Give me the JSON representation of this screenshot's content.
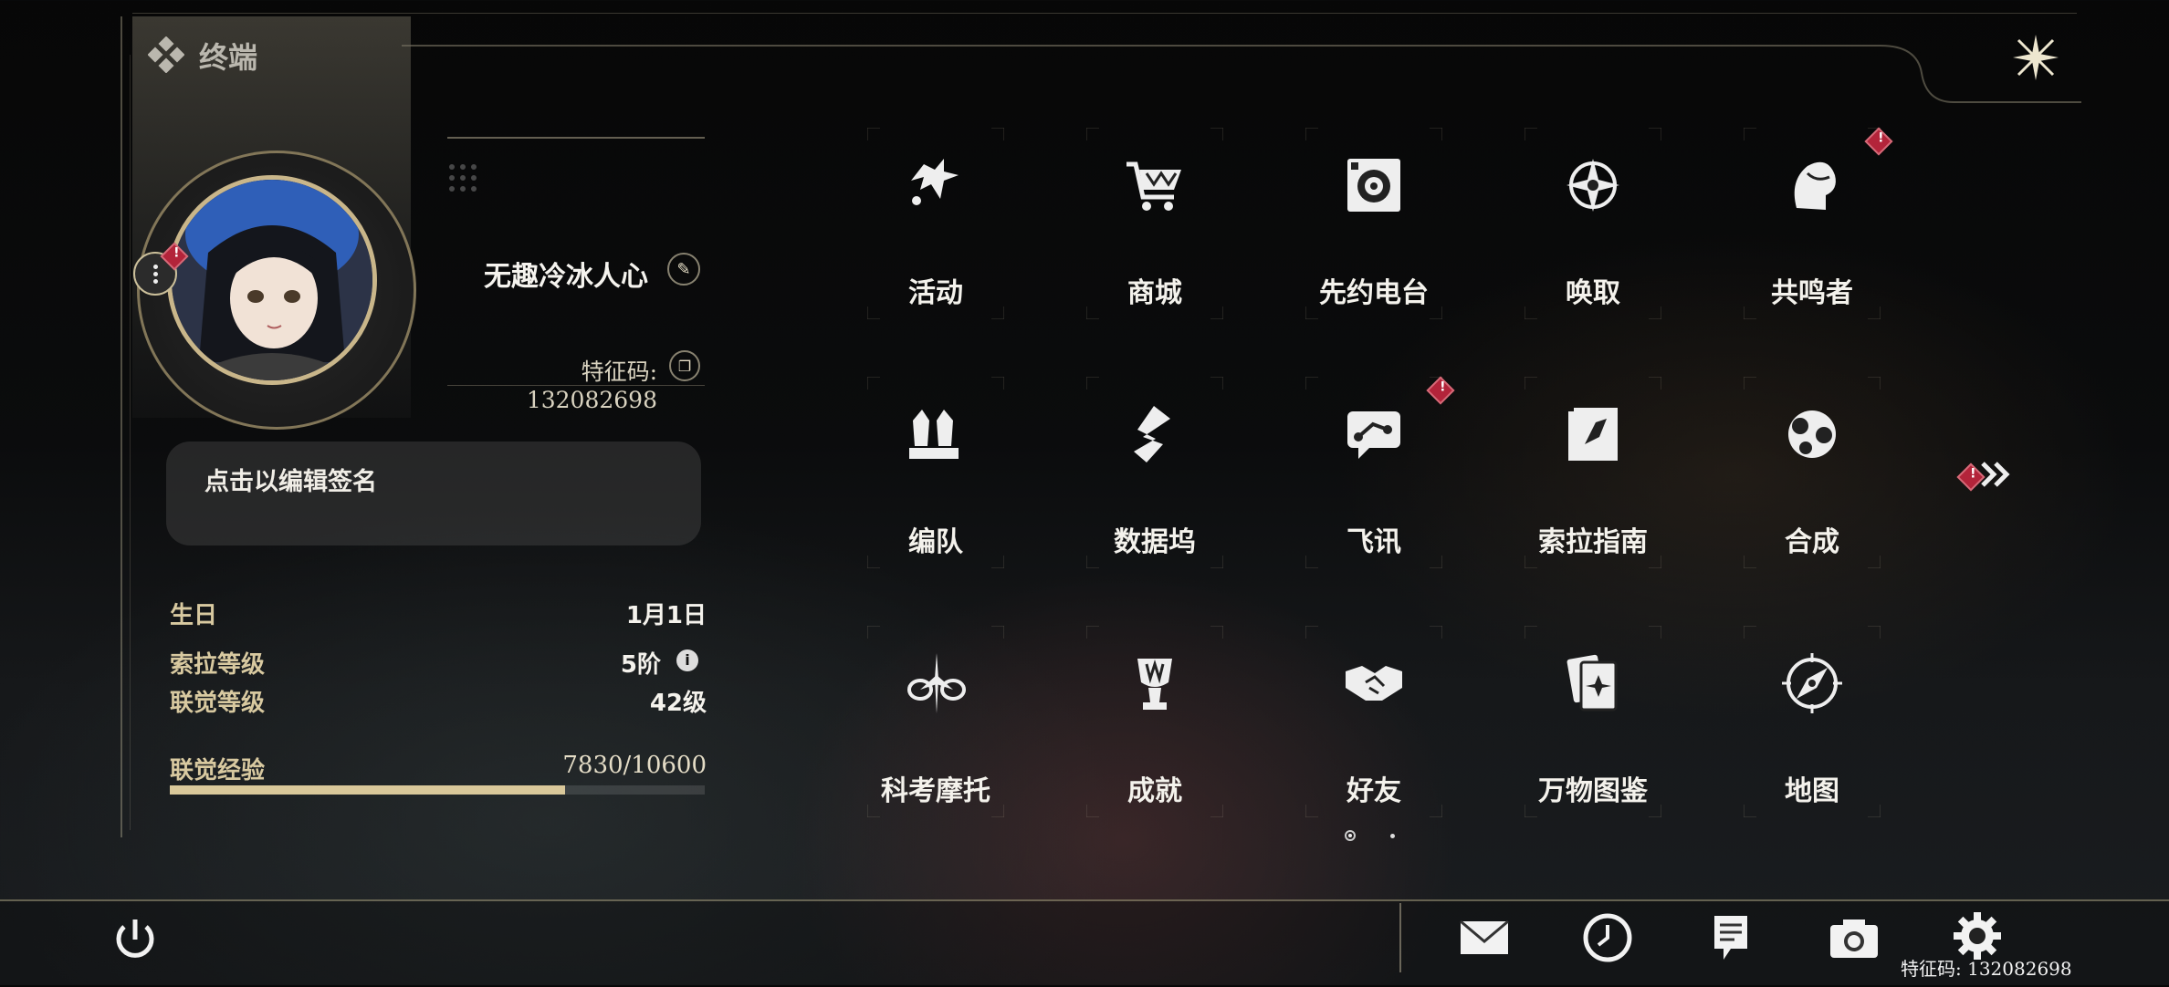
{
  "header": {
    "title": "终端",
    "close_icon": "close-star-icon"
  },
  "profile": {
    "name": "无趣冷冰人心",
    "id_label": "特征码",
    "id_value": "132082698",
    "id_text": "特征码: 132082698",
    "signature_placeholder": "点击以编辑签名"
  },
  "stats": {
    "birthday_label": "生日",
    "birthday_value": "1月1日",
    "sola_level_label": "索拉等级",
    "sola_level_value": "5阶",
    "union_level_label": "联觉等级",
    "union_level_value": "42级",
    "union_exp_label": "联觉经验",
    "union_exp_value": "7830/10600",
    "union_exp_progress": 0.7387
  },
  "menu": {
    "row1": [
      {
        "label": "活动",
        "icon": "events-icon",
        "badge": false
      },
      {
        "label": "商城",
        "icon": "shop-cart-icon",
        "badge": false
      },
      {
        "label": "先约电台",
        "icon": "radio-icon",
        "badge": false
      },
      {
        "label": "唤取",
        "icon": "convene-icon",
        "badge": false
      },
      {
        "label": "共鸣者",
        "icon": "resonator-icon",
        "badge": true
      }
    ],
    "row2": [
      {
        "label": "编队",
        "icon": "team-icon",
        "badge": false
      },
      {
        "label": "数据坞",
        "icon": "data-bank-icon",
        "badge": false
      },
      {
        "label": "飞讯",
        "icon": "message-icon",
        "badge": true
      },
      {
        "label": "索拉指南",
        "icon": "guidebook-icon",
        "badge": false
      },
      {
        "label": "合成",
        "icon": "synthesis-icon",
        "badge": false
      }
    ],
    "row3": [
      {
        "label": "科考摩托",
        "icon": "motorcycle-icon",
        "badge": false
      },
      {
        "label": "成就",
        "icon": "trophy-icon",
        "badge": false
      },
      {
        "label": "好友",
        "icon": "handshake-icon",
        "badge": false
      },
      {
        "label": "万物图鉴",
        "icon": "card-collection-icon",
        "badge": false
      },
      {
        "label": "地图",
        "icon": "compass-map-icon",
        "badge": false
      }
    ],
    "pages": 2,
    "current_page": 1
  },
  "bottom": {
    "icons": [
      "power-icon",
      "mail-icon",
      "clock-icon",
      "notes-icon",
      "camera-icon",
      "settings-icon"
    ],
    "footer_id": "特征码: 132082698"
  },
  "colors": {
    "accent": "#d9c89a",
    "badge": "#b3243a",
    "text": "#f4f2ec"
  }
}
